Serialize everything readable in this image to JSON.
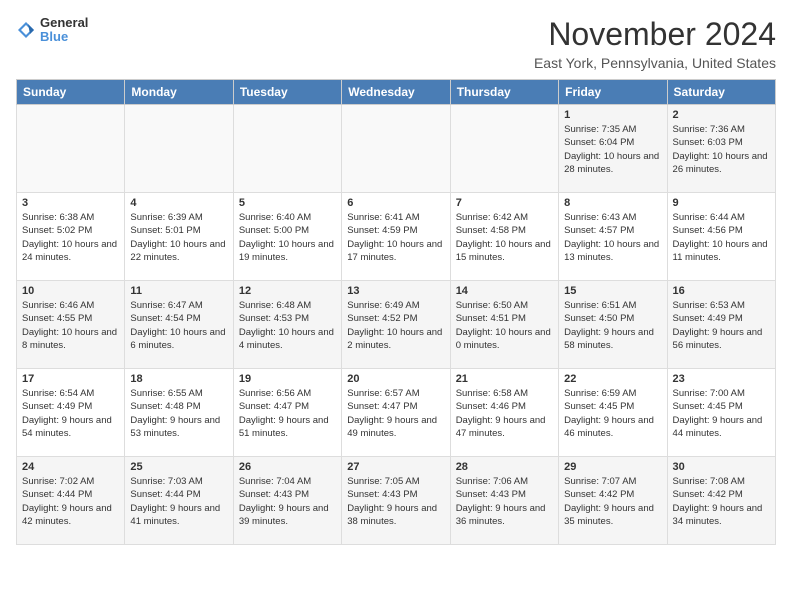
{
  "logo": {
    "general": "General",
    "blue": "Blue"
  },
  "header": {
    "month_title": "November 2024",
    "location": "East York, Pennsylvania, United States"
  },
  "weekdays": [
    "Sunday",
    "Monday",
    "Tuesday",
    "Wednesday",
    "Thursday",
    "Friday",
    "Saturday"
  ],
  "weeks": [
    [
      {
        "day": "",
        "info": ""
      },
      {
        "day": "",
        "info": ""
      },
      {
        "day": "",
        "info": ""
      },
      {
        "day": "",
        "info": ""
      },
      {
        "day": "",
        "info": ""
      },
      {
        "day": "1",
        "info": "Sunrise: 7:35 AM\nSunset: 6:04 PM\nDaylight: 10 hours and 28 minutes."
      },
      {
        "day": "2",
        "info": "Sunrise: 7:36 AM\nSunset: 6:03 PM\nDaylight: 10 hours and 26 minutes."
      }
    ],
    [
      {
        "day": "3",
        "info": "Sunrise: 6:38 AM\nSunset: 5:02 PM\nDaylight: 10 hours and 24 minutes."
      },
      {
        "day": "4",
        "info": "Sunrise: 6:39 AM\nSunset: 5:01 PM\nDaylight: 10 hours and 22 minutes."
      },
      {
        "day": "5",
        "info": "Sunrise: 6:40 AM\nSunset: 5:00 PM\nDaylight: 10 hours and 19 minutes."
      },
      {
        "day": "6",
        "info": "Sunrise: 6:41 AM\nSunset: 4:59 PM\nDaylight: 10 hours and 17 minutes."
      },
      {
        "day": "7",
        "info": "Sunrise: 6:42 AM\nSunset: 4:58 PM\nDaylight: 10 hours and 15 minutes."
      },
      {
        "day": "8",
        "info": "Sunrise: 6:43 AM\nSunset: 4:57 PM\nDaylight: 10 hours and 13 minutes."
      },
      {
        "day": "9",
        "info": "Sunrise: 6:44 AM\nSunset: 4:56 PM\nDaylight: 10 hours and 11 minutes."
      }
    ],
    [
      {
        "day": "10",
        "info": "Sunrise: 6:46 AM\nSunset: 4:55 PM\nDaylight: 10 hours and 8 minutes."
      },
      {
        "day": "11",
        "info": "Sunrise: 6:47 AM\nSunset: 4:54 PM\nDaylight: 10 hours and 6 minutes."
      },
      {
        "day": "12",
        "info": "Sunrise: 6:48 AM\nSunset: 4:53 PM\nDaylight: 10 hours and 4 minutes."
      },
      {
        "day": "13",
        "info": "Sunrise: 6:49 AM\nSunset: 4:52 PM\nDaylight: 10 hours and 2 minutes."
      },
      {
        "day": "14",
        "info": "Sunrise: 6:50 AM\nSunset: 4:51 PM\nDaylight: 10 hours and 0 minutes."
      },
      {
        "day": "15",
        "info": "Sunrise: 6:51 AM\nSunset: 4:50 PM\nDaylight: 9 hours and 58 minutes."
      },
      {
        "day": "16",
        "info": "Sunrise: 6:53 AM\nSunset: 4:49 PM\nDaylight: 9 hours and 56 minutes."
      }
    ],
    [
      {
        "day": "17",
        "info": "Sunrise: 6:54 AM\nSunset: 4:49 PM\nDaylight: 9 hours and 54 minutes."
      },
      {
        "day": "18",
        "info": "Sunrise: 6:55 AM\nSunset: 4:48 PM\nDaylight: 9 hours and 53 minutes."
      },
      {
        "day": "19",
        "info": "Sunrise: 6:56 AM\nSunset: 4:47 PM\nDaylight: 9 hours and 51 minutes."
      },
      {
        "day": "20",
        "info": "Sunrise: 6:57 AM\nSunset: 4:47 PM\nDaylight: 9 hours and 49 minutes."
      },
      {
        "day": "21",
        "info": "Sunrise: 6:58 AM\nSunset: 4:46 PM\nDaylight: 9 hours and 47 minutes."
      },
      {
        "day": "22",
        "info": "Sunrise: 6:59 AM\nSunset: 4:45 PM\nDaylight: 9 hours and 46 minutes."
      },
      {
        "day": "23",
        "info": "Sunrise: 7:00 AM\nSunset: 4:45 PM\nDaylight: 9 hours and 44 minutes."
      }
    ],
    [
      {
        "day": "24",
        "info": "Sunrise: 7:02 AM\nSunset: 4:44 PM\nDaylight: 9 hours and 42 minutes."
      },
      {
        "day": "25",
        "info": "Sunrise: 7:03 AM\nSunset: 4:44 PM\nDaylight: 9 hours and 41 minutes."
      },
      {
        "day": "26",
        "info": "Sunrise: 7:04 AM\nSunset: 4:43 PM\nDaylight: 9 hours and 39 minutes."
      },
      {
        "day": "27",
        "info": "Sunrise: 7:05 AM\nSunset: 4:43 PM\nDaylight: 9 hours and 38 minutes."
      },
      {
        "day": "28",
        "info": "Sunrise: 7:06 AM\nSunset: 4:43 PM\nDaylight: 9 hours and 36 minutes."
      },
      {
        "day": "29",
        "info": "Sunrise: 7:07 AM\nSunset: 4:42 PM\nDaylight: 9 hours and 35 minutes."
      },
      {
        "day": "30",
        "info": "Sunrise: 7:08 AM\nSunset: 4:42 PM\nDaylight: 9 hours and 34 minutes."
      }
    ]
  ]
}
